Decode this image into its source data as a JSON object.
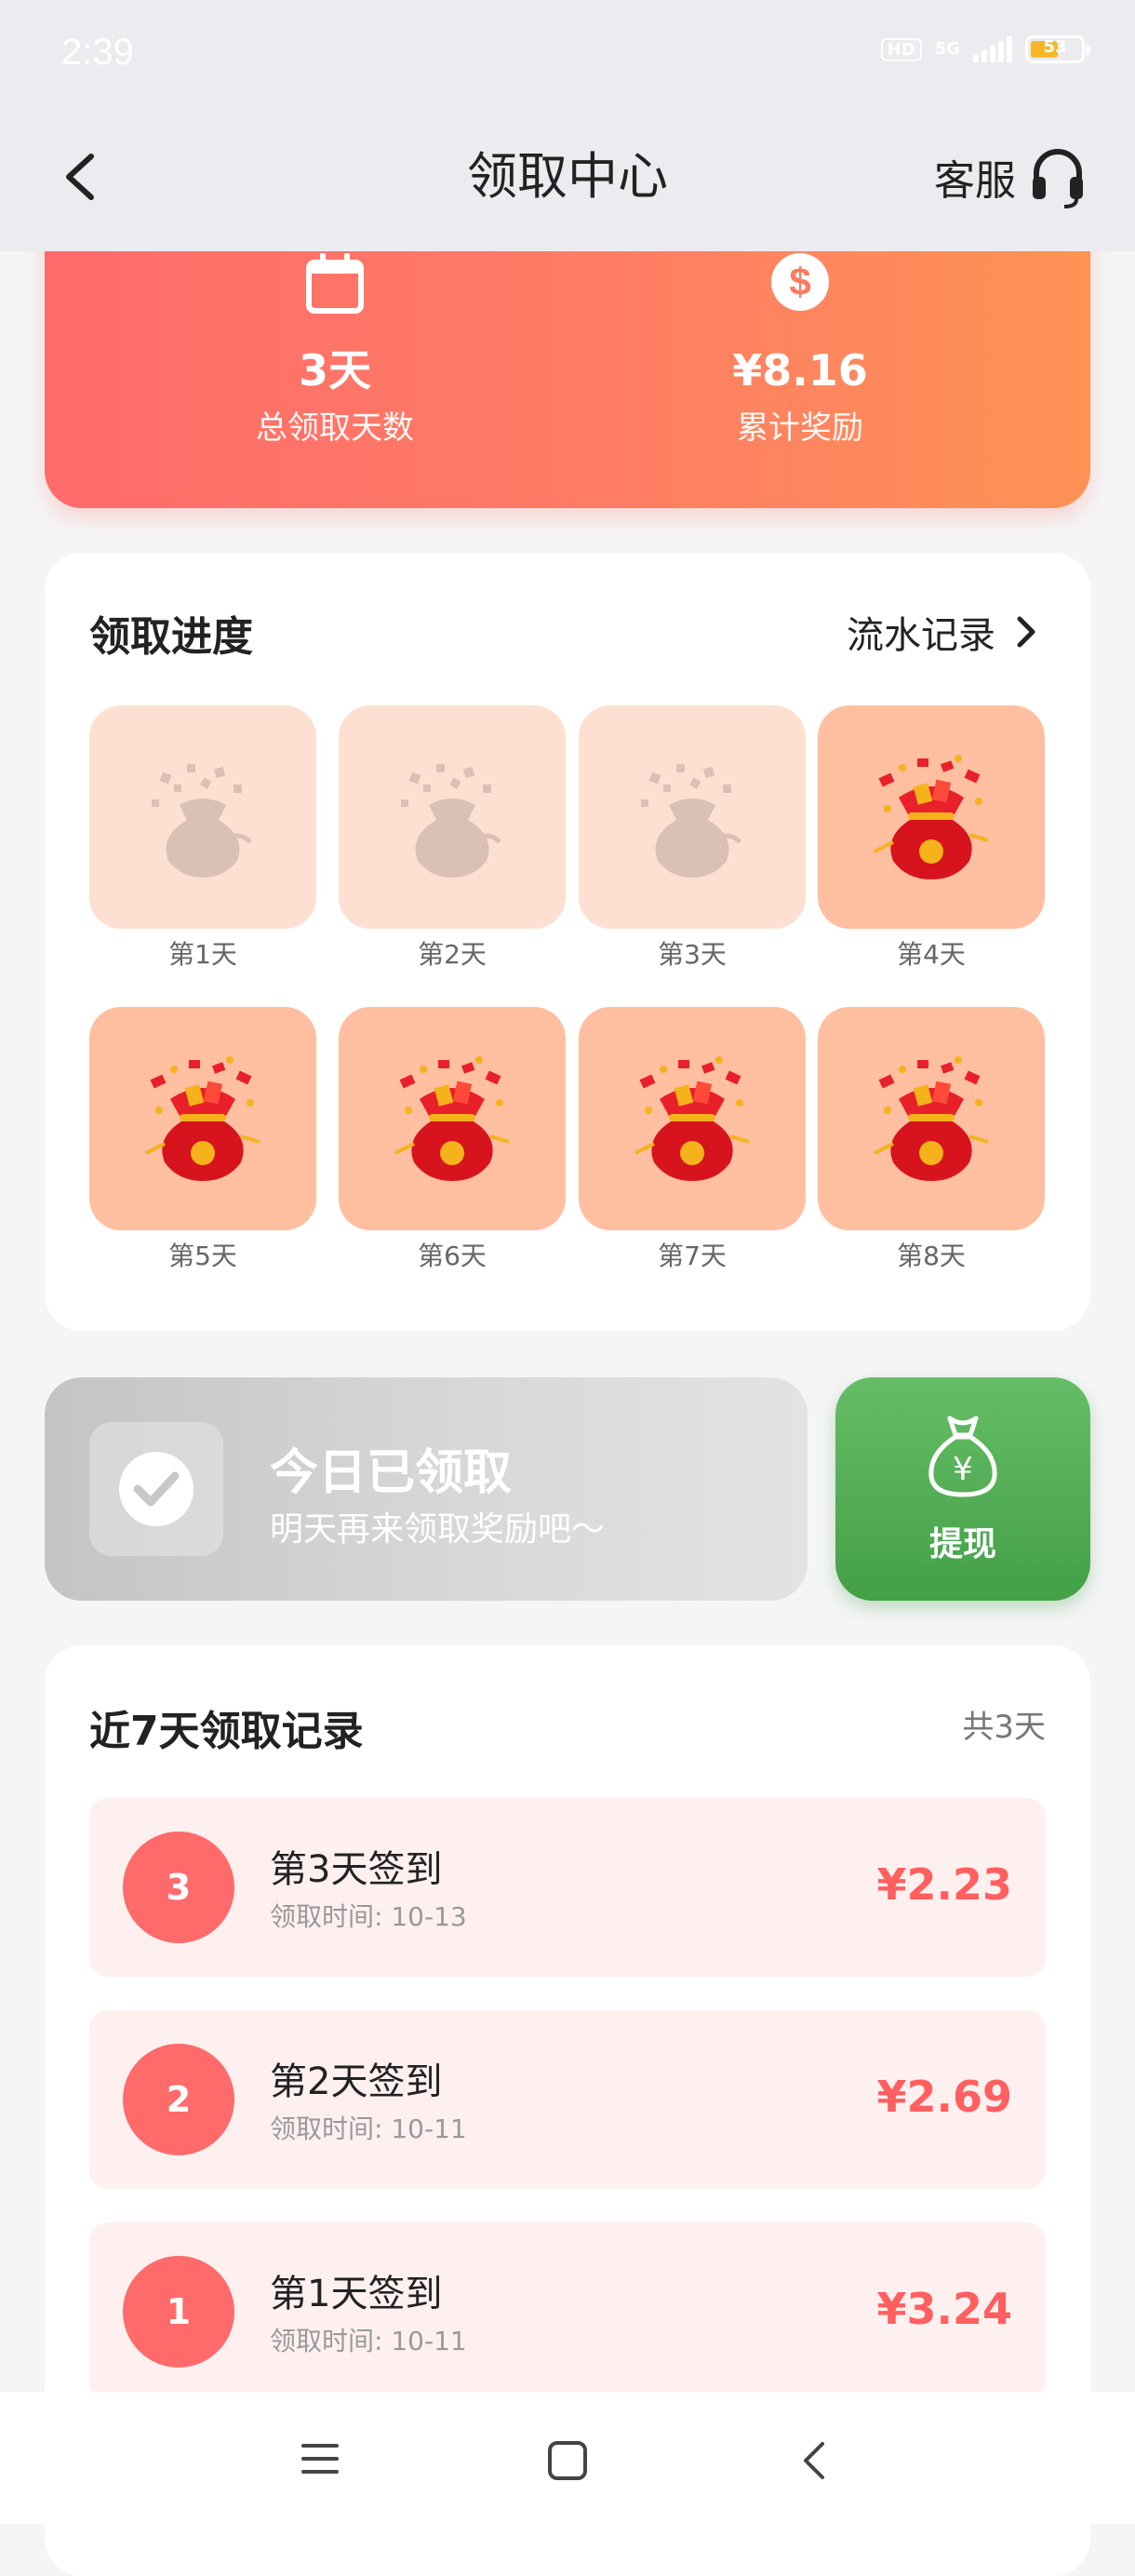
{
  "status_bar": {
    "time": "2:39",
    "hd": "HD",
    "network": "5G",
    "battery": "53"
  },
  "header": {
    "title": "领取中心",
    "service_label": "客服"
  },
  "summary": {
    "days_value": "3天",
    "days_label": "总领取天数",
    "reward_value": "¥8.16",
    "reward_label": "累计奖励"
  },
  "progress": {
    "title": "领取进度",
    "records_link": "流水记录",
    "days": [
      {
        "label": "第1天",
        "state": "claimed"
      },
      {
        "label": "第2天",
        "state": "claimed"
      },
      {
        "label": "第3天",
        "state": "claimed"
      },
      {
        "label": "第4天",
        "state": "pending"
      },
      {
        "label": "第5天",
        "state": "pending"
      },
      {
        "label": "第6天",
        "state": "pending"
      },
      {
        "label": "第7天",
        "state": "pending"
      },
      {
        "label": "第8天",
        "state": "pending"
      }
    ]
  },
  "today": {
    "title": "今日已领取",
    "subtitle": "明天再来领取奖励吧～"
  },
  "withdraw": {
    "label": "提现"
  },
  "records": {
    "title": "近7天领取记录",
    "count": "共3天",
    "items": [
      {
        "badge": "3",
        "title": "第3天签到",
        "time": "领取时间: 10-13",
        "amount": "¥2.23"
      },
      {
        "badge": "2",
        "title": "第2天签到",
        "time": "领取时间: 10-11",
        "amount": "¥2.69"
      },
      {
        "badge": "1",
        "title": "第1天签到",
        "time": "领取时间: 10-11",
        "amount": "¥3.24"
      }
    ]
  },
  "colors": {
    "accent": "#ff6b6b",
    "accent_end": "#ff9255",
    "withdraw_green": "#4caf50",
    "tile_claimed": "#fde0d2",
    "tile_pending": "#ffbfa0"
  },
  "icons": {
    "back": "chevron-left-icon",
    "service": "headset-icon",
    "calendar": "calendar-icon",
    "dollar": "dollar-icon",
    "chevron": "chevron-right-icon",
    "check": "check-icon",
    "money_bag": "money-bag-icon",
    "nav_menu": "menu-icon",
    "nav_home": "home-icon",
    "nav_back": "back-icon"
  }
}
